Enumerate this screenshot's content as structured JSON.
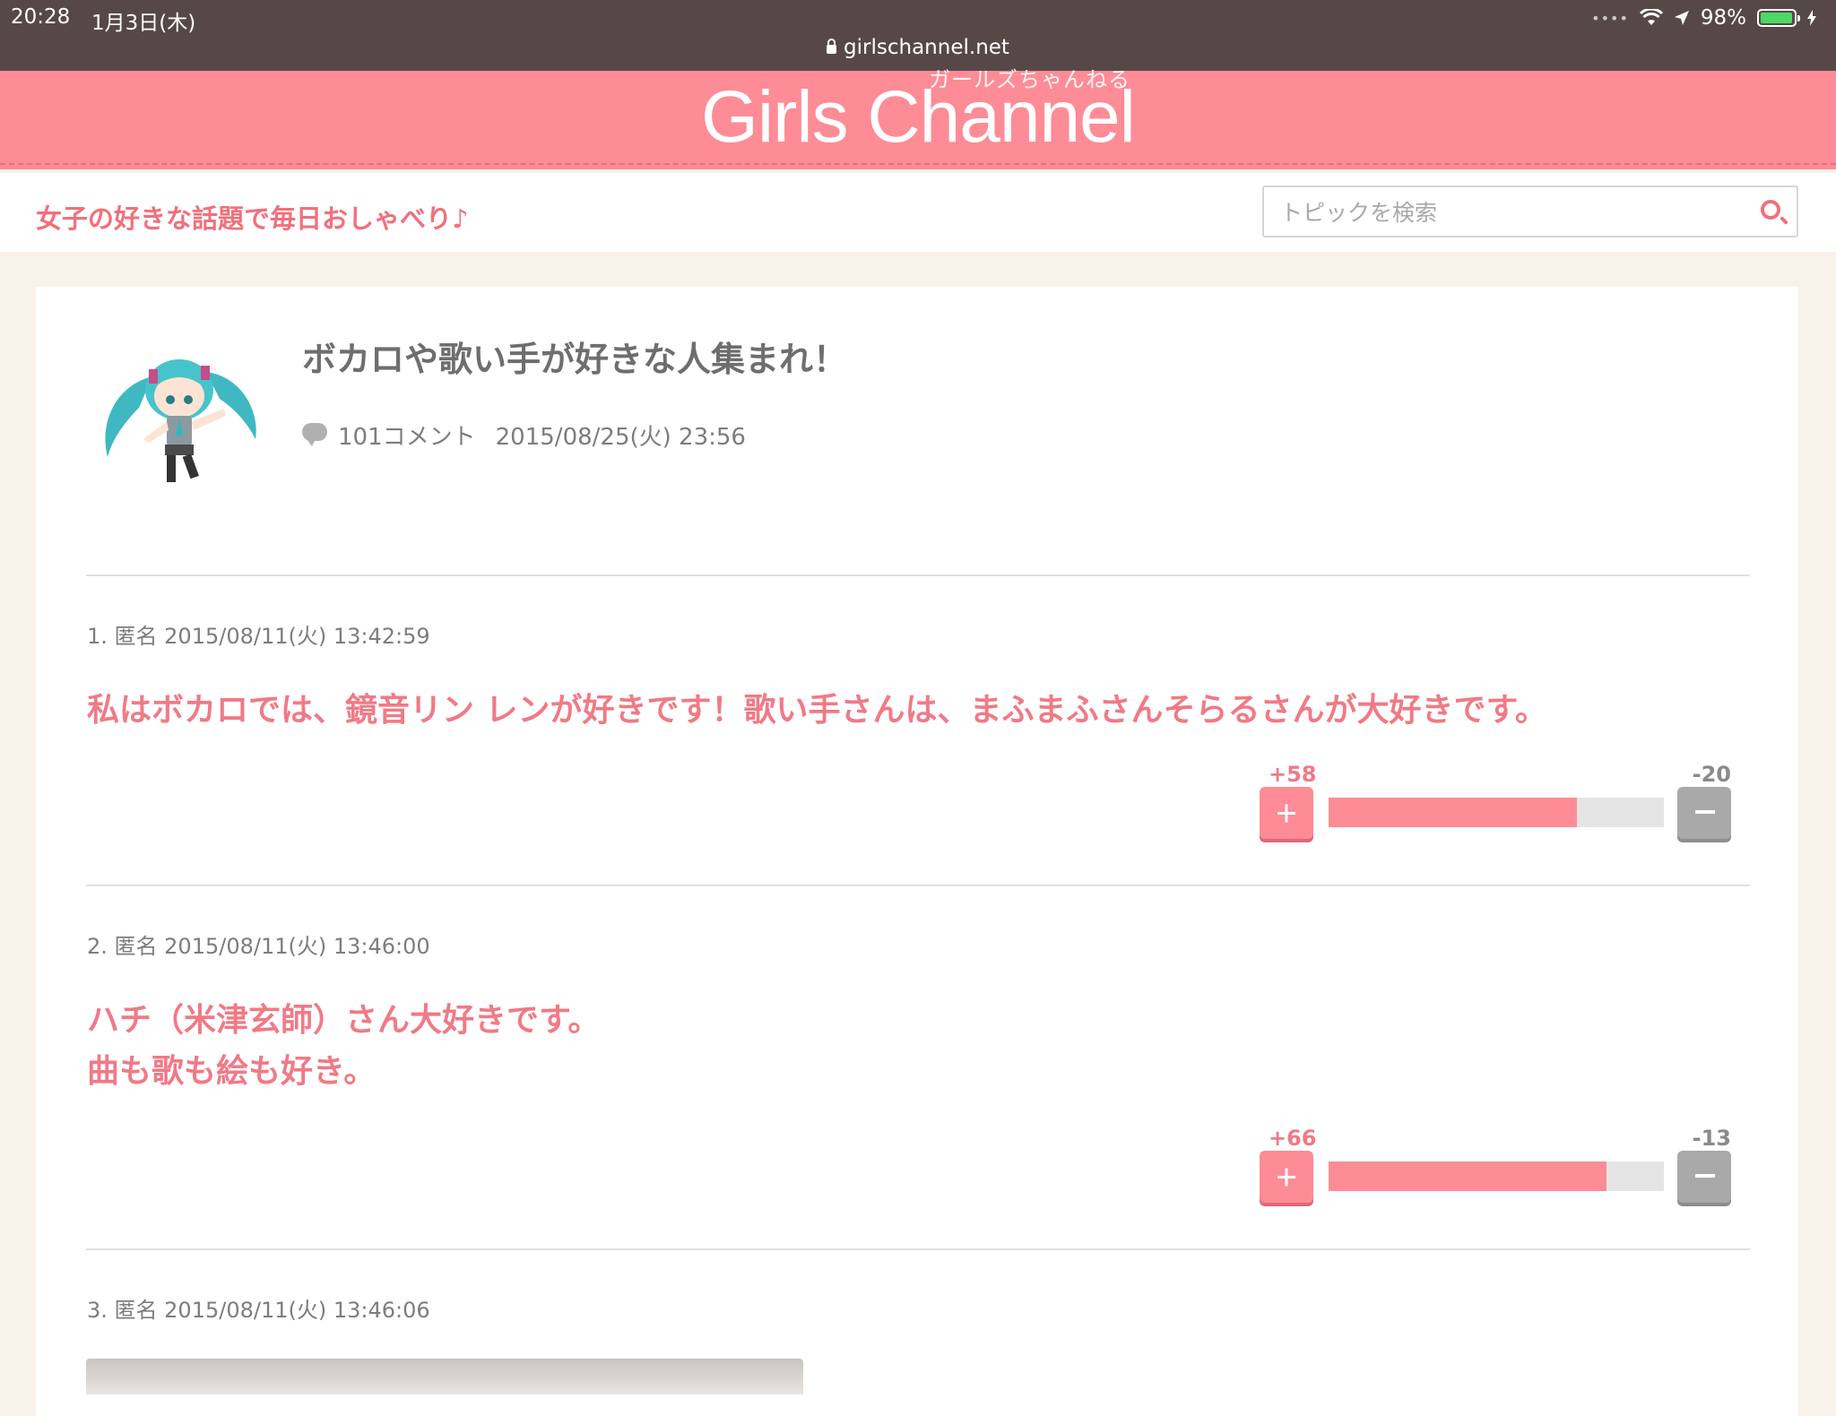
{
  "status_bar": {
    "time": "20:28",
    "date": "1月3日(木)",
    "battery": "98%",
    "battery_level": 0.98,
    "url": "girlschannel.net"
  },
  "header": {
    "logo_kana": "ガールズちゃんねる",
    "logo": "Girls Channel"
  },
  "tagline": "女子の好きな話題で毎日おしゃべり♪",
  "search": {
    "placeholder": "トピックを検索"
  },
  "topic": {
    "title": "ボカロや歌い手が好きな人集まれ！",
    "comment_count": "101コメント",
    "date": "2015/08/25(火) 23:56"
  },
  "comments": [
    {
      "header": "1. 匿名 2015/08/11(火) 13:42:59",
      "lines": [
        "私はボカロでは、鏡音リン レンが好きです！歌い手さんは、まふまふさんそらるさんが大好きです。"
      ],
      "plus": "+58",
      "minus": "-20",
      "ratio": 0.74
    },
    {
      "header": "2. 匿名 2015/08/11(火) 13:46:00",
      "lines": [
        "ハチ（米津玄師）さん大好きです。",
        "曲も歌も絵も好き。"
      ],
      "plus": "+66",
      "minus": "-13",
      "ratio": 0.83
    },
    {
      "header": "3. 匿名 2015/08/11(火) 13:46:06"
    }
  ],
  "icons": {
    "search": "search-icon",
    "comment": "speech-bubble-icon",
    "plus": "plus-icon",
    "minus": "minus-icon",
    "lock": "lock-icon"
  },
  "colors": {
    "brand_pink": "#fd8c96",
    "text_pink": "#f07a86",
    "status_bar": "#574848"
  }
}
